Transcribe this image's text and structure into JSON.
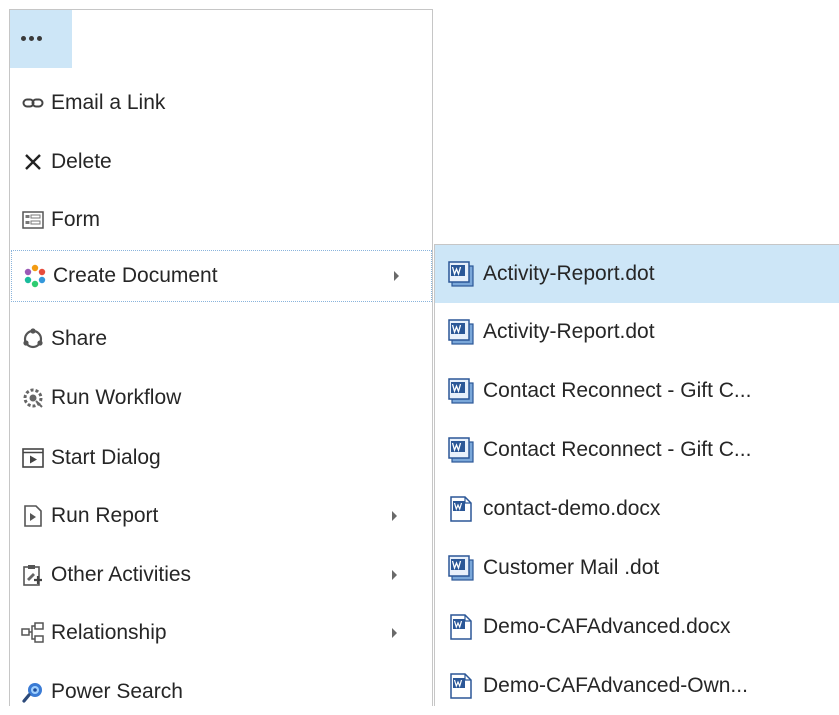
{
  "menu": {
    "ellipsis_icon": "ellipsis-icon",
    "items": [
      {
        "label": "Email a Link",
        "icon": "link-icon"
      },
      {
        "label": "Delete",
        "icon": "delete-x-icon"
      },
      {
        "label": "Form",
        "icon": "form-icon"
      },
      {
        "label": "Create Document",
        "icon": "create-document-icon",
        "submenu": true
      },
      {
        "label": "Share",
        "icon": "share-icon"
      },
      {
        "label": "Run Workflow",
        "icon": "workflow-icon"
      },
      {
        "label": "Start Dialog",
        "icon": "start-dialog-icon"
      },
      {
        "label": "Run Report",
        "icon": "report-icon",
        "submenu": true
      },
      {
        "label": "Other Activities",
        "icon": "other-activities-icon",
        "submenu": true
      },
      {
        "label": "Relationship",
        "icon": "relationship-icon",
        "submenu": true
      },
      {
        "label": "Power Search",
        "icon": "power-search-icon"
      }
    ]
  },
  "submenu": {
    "items": [
      {
        "label": "Activity-Report.dot",
        "icon": "word-template-icon"
      },
      {
        "label": "Activity-Report.dot",
        "icon": "word-template-icon"
      },
      {
        "label": "Contact Reconnect - Gift C...",
        "icon": "word-template-icon"
      },
      {
        "label": "Contact Reconnect - Gift C...",
        "icon": "word-template-icon"
      },
      {
        "label": "contact-demo.docx",
        "icon": "word-document-icon"
      },
      {
        "label": "Customer Mail .dot",
        "icon": "word-template-icon"
      },
      {
        "label": "Demo-CAFAdvanced.docx",
        "icon": "word-document-icon"
      },
      {
        "label": "Demo-CAFAdvanced-Own...",
        "icon": "word-document-icon"
      }
    ]
  },
  "colors": {
    "highlight": "#cde6f7",
    "border": "#c6c6c6",
    "text": "#262626"
  }
}
